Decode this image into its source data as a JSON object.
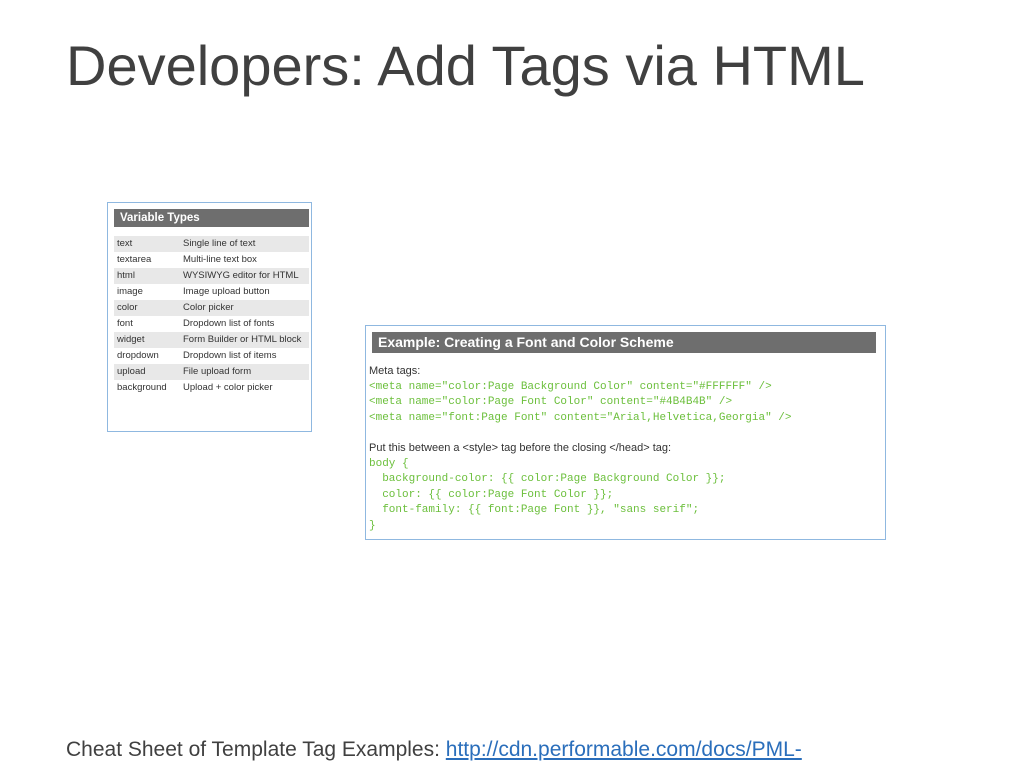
{
  "title": "Developers: Add Tags via HTML",
  "variable_types": {
    "heading": "Variable Types",
    "rows": [
      {
        "name": "text",
        "description": "Single line of text"
      },
      {
        "name": "textarea",
        "description": "Multi-line text box"
      },
      {
        "name": "html",
        "description": "WYSIWYG editor for HTML"
      },
      {
        "name": "image",
        "description": "Image upload button"
      },
      {
        "name": "color",
        "description": "Color picker"
      },
      {
        "name": "font",
        "description": "Dropdown list of fonts"
      },
      {
        "name": "widget",
        "description": "Form Builder or HTML block"
      },
      {
        "name": "dropdown",
        "description": "Dropdown list of items"
      },
      {
        "name": "upload",
        "description": "File upload form"
      },
      {
        "name": "background",
        "description": "Upload + color picker"
      }
    ]
  },
  "example": {
    "heading": "Example: Creating a Font and Color Scheme",
    "meta_label": "Meta tags:",
    "meta_lines": [
      "<meta name=\"color:Page Background Color\" content=\"#FFFFFF\" />",
      "<meta name=\"color:Page Font Color\" content=\"#4B4B4B\" />",
      "<meta name=\"font:Page Font\" content=\"Arial,Helvetica,Georgia\" />"
    ],
    "instruction": "Put this between a <style> tag before the closing </head> tag:",
    "css_lines": [
      "body {",
      "  background-color: {{ color:Page Background Color }};",
      "  color: {{ color:Page Font Color }};",
      "  font-family: {{ font:Page Font }}, \"sans serif\";",
      "}"
    ]
  },
  "footer": {
    "label": "Cheat Sheet of Template Tag Examples: ",
    "link": "http://cdn.performable.com/docs/PML-"
  },
  "colors": {
    "header_bg": "#6e6e6e",
    "code_green": "#6bbf3b",
    "border_blue": "#8fb8e0",
    "link_blue": "#2a6ebb"
  }
}
